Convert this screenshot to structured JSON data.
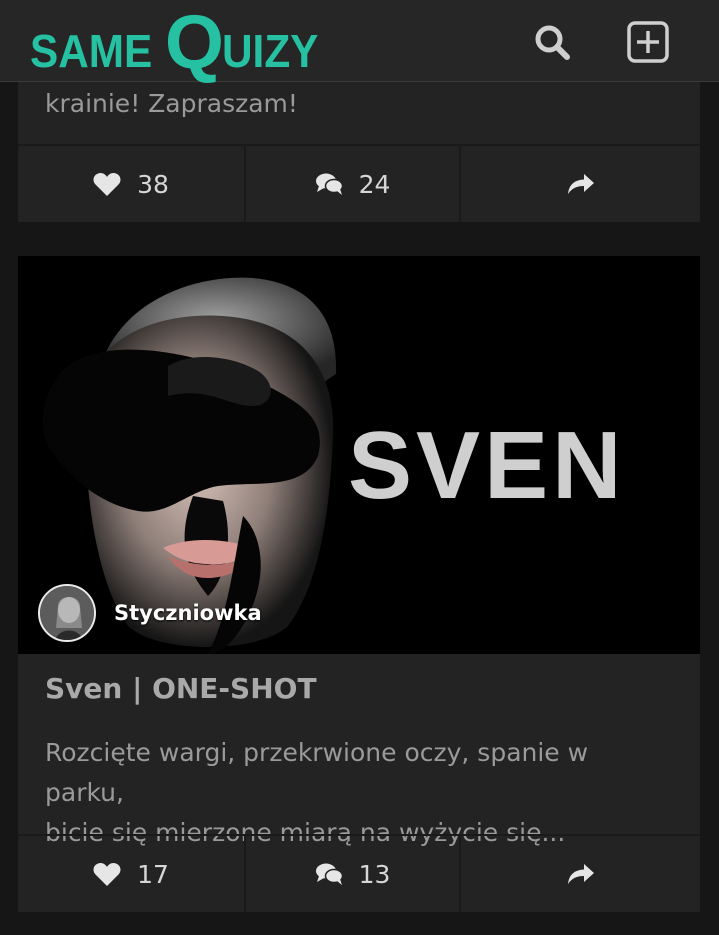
{
  "header": {
    "logo_same": "SAME",
    "logo_q": "Q",
    "logo_uizy": "UIZY",
    "search_icon": "search-icon",
    "add_icon": "plus-square-icon",
    "accent": "#25c1a2"
  },
  "posts": [
    {
      "excerpt": "krainie! Zapraszam!",
      "likes": "38",
      "comments": "24"
    },
    {
      "cover_text": "SVEN",
      "author": "Styczniowka",
      "title": "Sven | ONE-SHOT",
      "excerpt_line1": "Rozcięte wargi, przekrwione oczy, spanie w parku,",
      "excerpt_line2": "bicie się mierzone miarą na wyżycie się...",
      "likes": "17",
      "comments": "13"
    }
  ]
}
